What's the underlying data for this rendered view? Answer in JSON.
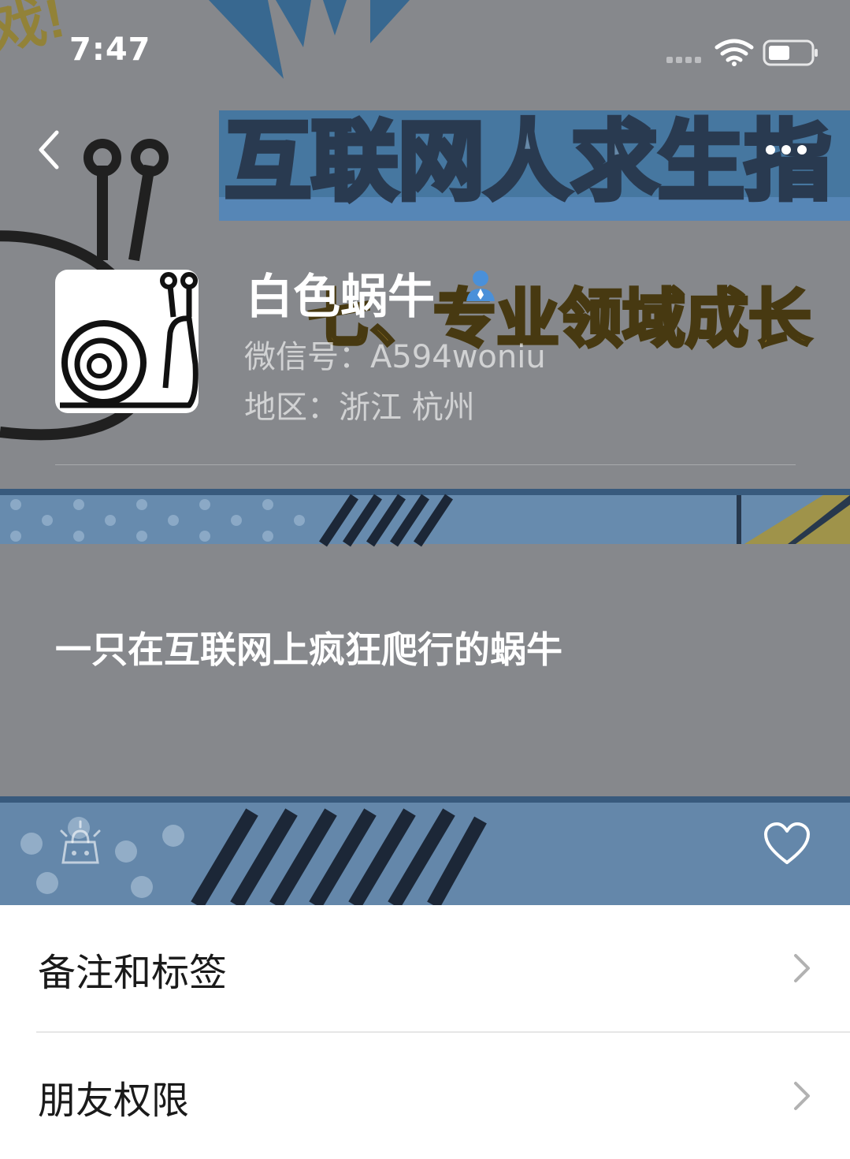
{
  "status_bar": {
    "time": "7:47",
    "wifi_icon": "wifi-icon",
    "battery_icon": "battery-icon"
  },
  "nav": {
    "back_icon": "chevron-left-icon",
    "more_icon": "more-dots-icon"
  },
  "profile": {
    "name": "白色蜗牛",
    "wechat_id": "微信号：A594woniu",
    "region": "地区：浙江 杭州",
    "signature": "一只在互联网上疯狂爬行的蜗牛",
    "avatar_icon": "snail-avatar-icon",
    "verified_icon": "user-badge-icon",
    "cover_text_line1": "互联网人求生指",
    "cover_text_line2": "七、专业领域成长"
  },
  "actions": {
    "shop_icon": "shop-bag-icon",
    "like_icon": "heart-icon"
  },
  "menu": [
    {
      "label": "备注和标签"
    },
    {
      "label": "朋友权限"
    }
  ],
  "colors": {
    "overlay": "#8f9195",
    "cover_blue": "#5b87b3",
    "cover_yellow": "#b08a2e",
    "text_white": "#ffffff",
    "menu_text": "#1a1a1a",
    "chevron": "#b2b2b2"
  }
}
